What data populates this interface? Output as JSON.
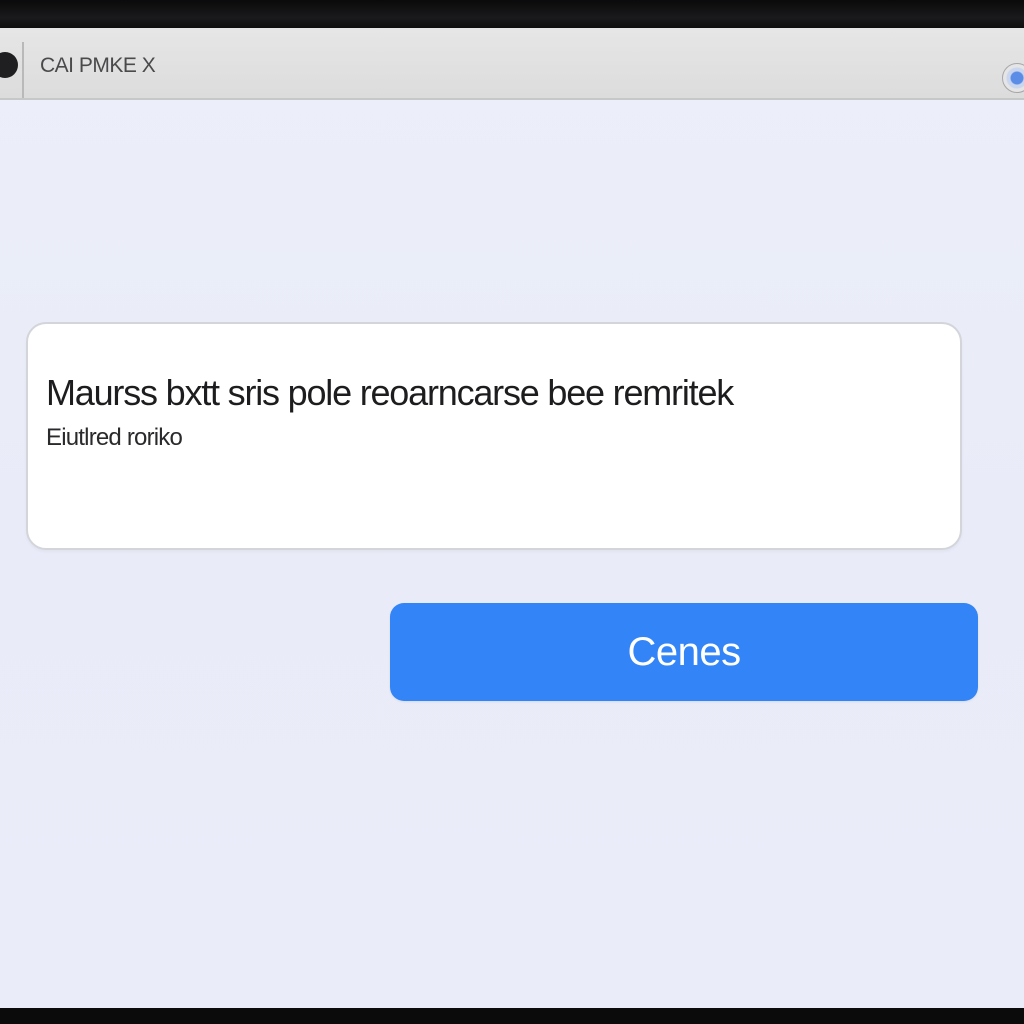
{
  "window": {
    "title": "CAI PMKE X"
  },
  "dialog": {
    "message_primary": "Maurss bxtt sris pole reoarncarse bee remritek",
    "message_secondary": "Eiutlred roriko"
  },
  "actions": {
    "primary_label": "Cenes"
  },
  "colors": {
    "accent": "#3284f7",
    "background": "#eceff9",
    "titlebar": "#dcdcdc"
  }
}
